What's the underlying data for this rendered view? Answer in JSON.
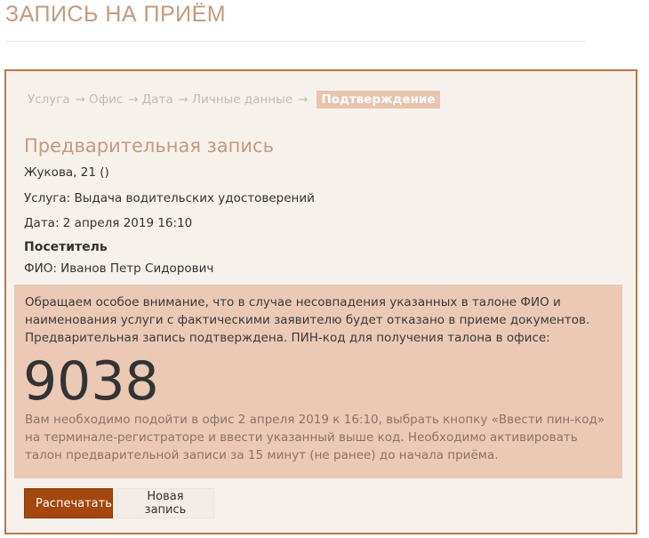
{
  "page": {
    "title": "ЗАПИСЬ НА ПРИЁМ"
  },
  "steps": {
    "items": [
      "Услуга",
      "Офис",
      "Дата",
      "Личные данные"
    ],
    "arrow": "→",
    "active": "Подтверждение"
  },
  "booking": {
    "title": "Предварительная запись",
    "office": "Жукова, 21 ()",
    "service": "Услуга: Выдача водительских удостоверений",
    "date": "Дата: 2 апреля 2019 16:10"
  },
  "visitor": {
    "heading": "Посетитель",
    "name": "ФИО: Иванов Петр Сидорович"
  },
  "notice": {
    "text": "Обращаем особое внимание, что в случае несовпадения указанных в талоне ФИО и наименования услуги с фактическими заявителю будет отказано в приеме документов. Предварительная запись подтверждена. ПИН-код для получения талона в офисе:",
    "pin": "9038",
    "instructions": "Вам необходимо подойти в офис 2 апреля 2019 к 16:10, выбрать кнопку «Ввести пин-код» на терминале-регистраторе и ввести указанный выше код. Необходимо активировать талон предварительной записи за 15 минут (не ранее) до начала приёма."
  },
  "actions": {
    "print_label": "Распечатать",
    "new_label": "Новая запись"
  },
  "colors": {
    "accent": "#c49a7d",
    "panel_border": "#b5794a",
    "panel_bg": "#f7f1ec",
    "notice_bg": "#ebc9b5",
    "primary_button": "#a3470e"
  }
}
